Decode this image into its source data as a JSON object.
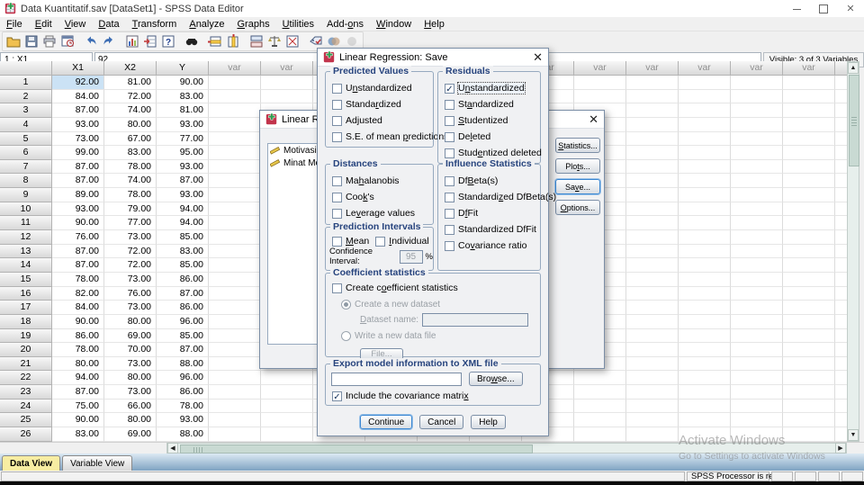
{
  "window": {
    "title": "Data Kuantitatif.sav [DataSet1] - SPSS Data Editor"
  },
  "menu": {
    "items": [
      {
        "label": "File",
        "u": 0
      },
      {
        "label": "Edit",
        "u": 0
      },
      {
        "label": "View",
        "u": 0
      },
      {
        "label": "Data",
        "u": 0
      },
      {
        "label": "Transform",
        "u": 0
      },
      {
        "label": "Analyze",
        "u": 0
      },
      {
        "label": "Graphs",
        "u": 0
      },
      {
        "label": "Utilities",
        "u": 0
      },
      {
        "label": "Add-ons",
        "u": 4
      },
      {
        "label": "Window",
        "u": 0
      },
      {
        "label": "Help",
        "u": 0
      }
    ]
  },
  "toolbar": {
    "icons": [
      "open-file",
      "save",
      "print",
      "dialog-recall",
      "sep",
      "undo",
      "redo",
      "sep",
      "goto-chart",
      "goto-case",
      "variables",
      "sep",
      "find",
      "sep",
      "insert-case",
      "insert-variable",
      "sep",
      "split-file",
      "weight-cases",
      "select-cases",
      "sep",
      "value-labels",
      "use-variable-sets",
      "show-all-variables"
    ]
  },
  "cellref": {
    "cell": "1 : X1",
    "value": "92",
    "visible": "Visible: 3 of 3 Variables"
  },
  "grid": {
    "data_columns": [
      "X1",
      "X2",
      "Y"
    ],
    "var_label": "var",
    "var_count": 13,
    "rows": [
      [
        "92.00",
        "81.00",
        "90.00"
      ],
      [
        "84.00",
        "72.00",
        "83.00"
      ],
      [
        "87.00",
        "74.00",
        "81.00"
      ],
      [
        "93.00",
        "80.00",
        "93.00"
      ],
      [
        "73.00",
        "67.00",
        "77.00"
      ],
      [
        "99.00",
        "83.00",
        "95.00"
      ],
      [
        "87.00",
        "78.00",
        "93.00"
      ],
      [
        "87.00",
        "74.00",
        "87.00"
      ],
      [
        "89.00",
        "78.00",
        "93.00"
      ],
      [
        "93.00",
        "79.00",
        "94.00"
      ],
      [
        "90.00",
        "77.00",
        "94.00"
      ],
      [
        "76.00",
        "73.00",
        "85.00"
      ],
      [
        "87.00",
        "72.00",
        "83.00"
      ],
      [
        "87.00",
        "72.00",
        "85.00"
      ],
      [
        "78.00",
        "73.00",
        "86.00"
      ],
      [
        "82.00",
        "76.00",
        "87.00"
      ],
      [
        "84.00",
        "73.00",
        "86.00"
      ],
      [
        "90.00",
        "80.00",
        "96.00"
      ],
      [
        "86.00",
        "69.00",
        "85.00"
      ],
      [
        "78.00",
        "70.00",
        "87.00"
      ],
      [
        "80.00",
        "73.00",
        "88.00"
      ],
      [
        "94.00",
        "80.00",
        "96.00"
      ],
      [
        "87.00",
        "73.00",
        "86.00"
      ],
      [
        "75.00",
        "66.00",
        "78.00"
      ],
      [
        "90.00",
        "80.00",
        "93.00"
      ],
      [
        "83.00",
        "69.00",
        "88.00"
      ],
      [
        "",
        "",
        ""
      ]
    ],
    "selected": {
      "row": 0,
      "col": 0
    }
  },
  "regression_dialog": {
    "title": "Linear Regression",
    "variables": [
      {
        "label": "Motivasi Mem"
      },
      {
        "label": "Minat Memb"
      }
    ],
    "buttons": [
      {
        "label": "Statistics...",
        "u": 0
      },
      {
        "label": "Plots...",
        "u": 3
      },
      {
        "label": "Save...",
        "u": 2,
        "focused": true
      },
      {
        "label": "Options...",
        "u": 0
      }
    ]
  },
  "save_dialog": {
    "title": "Linear Regression: Save",
    "predicted": {
      "title": "Predicted Values",
      "items": [
        {
          "label": "Unstandardized",
          "u": 1,
          "checked": false
        },
        {
          "label": "Standardized",
          "u": 6,
          "checked": false
        },
        {
          "label": "Adjusted",
          "u": 2,
          "checked": false
        },
        {
          "label": "S.E. of mean predictions",
          "u": 13,
          "checked": false
        }
      ]
    },
    "residuals": {
      "title": "Residuals",
      "items": [
        {
          "label": "Unstandardized",
          "u": 1,
          "checked": true,
          "focused": true
        },
        {
          "label": "Standardized",
          "u": 2,
          "checked": false
        },
        {
          "label": "Studentized",
          "u": 0,
          "checked": false
        },
        {
          "label": "Deleted",
          "u": 2,
          "checked": false
        },
        {
          "label": "Studentized deleted",
          "u": 4,
          "checked": false
        }
      ]
    },
    "distances": {
      "title": "Distances",
      "items": [
        {
          "label": "Mahalanobis",
          "u": 2,
          "checked": false
        },
        {
          "label": "Cook's",
          "u": 3,
          "checked": false
        },
        {
          "label": "Leverage values",
          "u": 2,
          "checked": false
        }
      ]
    },
    "intervals": {
      "title": "Prediction Intervals",
      "items": [
        {
          "label": "Mean",
          "u": 0,
          "checked": false
        },
        {
          "label": "Individual",
          "u": 0,
          "checked": false
        }
      ],
      "ci_label": "Confidence Interval:",
      "ci_value": "95",
      "ci_unit": "%"
    },
    "influence": {
      "title": "Influence Statistics",
      "items": [
        {
          "label": "DfBeta(s)",
          "u": 2,
          "checked": false
        },
        {
          "label": "Standardized DfBeta(s)",
          "u": 9,
          "checked": false
        },
        {
          "label": "DfFit",
          "u": 1,
          "checked": false
        },
        {
          "label": "Standardized DfFit",
          "checked": false
        },
        {
          "label": "Covariance ratio",
          "u": 2,
          "checked": false
        }
      ]
    },
    "coefficient": {
      "title": "Coefficient statistics",
      "create": {
        "label": "Create coefficient statistics",
        "u": 8,
        "checked": false
      },
      "radio_dataset": {
        "label": "Create a new dataset",
        "selected": true,
        "disabled": true
      },
      "dataset_label": "Dataset name:",
      "dataset_value": "",
      "radio_file": {
        "label": "Write a new data file",
        "selected": false,
        "disabled": true
      },
      "file_button": "File..."
    },
    "export": {
      "title": "Export model information to XML file",
      "path_value": "",
      "browse": {
        "label": "Browse...",
        "u": 3
      },
      "include": {
        "label": "Include the covariance matrix",
        "u": 28,
        "checked": true
      }
    },
    "buttons": [
      {
        "label": "Continue",
        "focused": true
      },
      {
        "label": "Cancel"
      },
      {
        "label": "Help"
      }
    ]
  },
  "tabs": [
    {
      "label": "Data View",
      "active": true
    },
    {
      "label": "Variable View",
      "active": false
    }
  ],
  "status": {
    "message": "SPSS Processor is ready",
    "small_panels": 4
  },
  "watermark": {
    "line1": "Activate Windows",
    "line2": "Go to Settings to activate Windows"
  }
}
